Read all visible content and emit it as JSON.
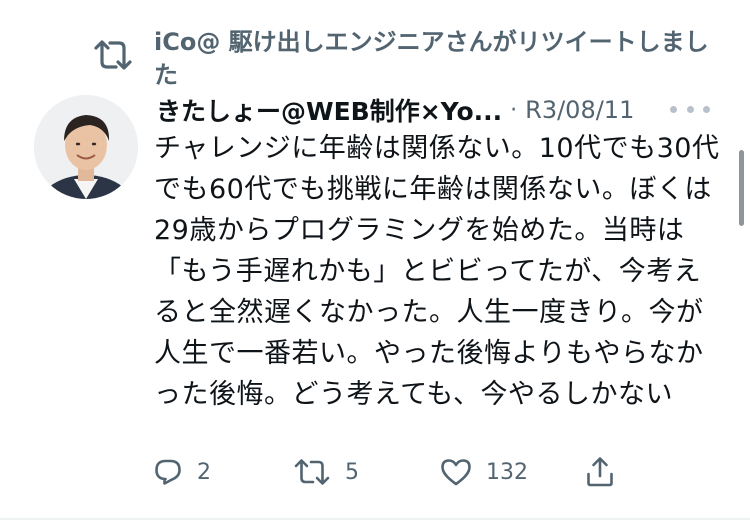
{
  "retweet_context": {
    "text": "iCo@ 駆け出しエンジニアさんがリツイートしました",
    "icon": "retweet-icon"
  },
  "tweet": {
    "author_name": "きたしょー@WEB制作×Yo...",
    "separator": "·",
    "date": "R3/08/11",
    "body": "チャレンジに年齢は関係ない。10代でも30代でも60代でも挑戦に年齢は関係ない。ぼくは29歳からプログラミングを始めた。当時は「もう手遅れかも」とビビってたが、今考えると全然遅くなかった。人生一度きり。今が人生で一番若い。やった後悔よりもやらなかった後悔。どう考えても、今やるしかない"
  },
  "actions": {
    "reply": {
      "icon": "reply-icon",
      "count": "2"
    },
    "retweet": {
      "icon": "retweet-icon",
      "count": "5"
    },
    "like": {
      "icon": "heart-icon",
      "count": "132"
    },
    "share": {
      "icon": "share-icon"
    }
  },
  "colors": {
    "text": "#0f1419",
    "muted": "#536471",
    "dots": "#b8c1c9",
    "scrollbar": "#8e959b"
  }
}
